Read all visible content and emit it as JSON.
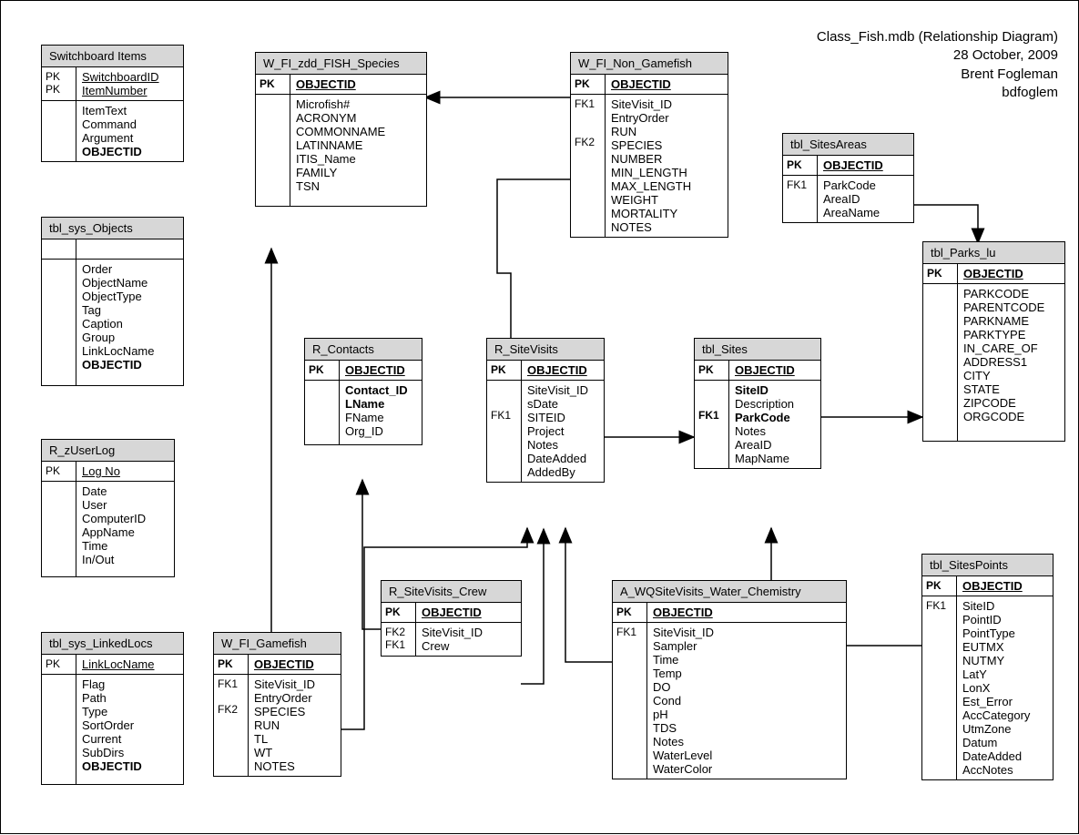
{
  "header": {
    "line1": "Class_Fish.mdb (Relationship Diagram)",
    "line2": "28 October, 2009",
    "line3": "Brent Fogleman",
    "line4": "bdfoglem"
  },
  "tables": {
    "switchboard": {
      "title": "Switchboard Items",
      "pk1_key": "PK",
      "pk1_field": "SwitchboardID",
      "pk2_key": "PK",
      "pk2_field": "ItemNumber",
      "f1": "ItemText",
      "f2": "Command",
      "f3": "Argument",
      "f4": "OBJECTID"
    },
    "sys_objects": {
      "title": "tbl_sys_Objects",
      "f1": "Order",
      "f2": "ObjectName",
      "f3": "ObjectType",
      "f4": "Tag",
      "f5": "Caption",
      "f6": "Group",
      "f7": "LinkLocName",
      "f8": "OBJECTID"
    },
    "userlog": {
      "title": "R_zUserLog",
      "pk_key": "PK",
      "pk_field": "Log No",
      "f1": "Date",
      "f2": "User",
      "f3": "ComputerID",
      "f4": "AppName",
      "f5": "Time",
      "f6": "In/Out"
    },
    "linkedlocs": {
      "title": "tbl_sys_LinkedLocs",
      "pk_key": "PK",
      "pk_field": "LinkLocName",
      "f1": "Flag",
      "f2": "Path",
      "f3": "Type",
      "f4": "SortOrder",
      "f5": "Current",
      "f6": "SubDirs",
      "f7": "OBJECTID"
    },
    "fish_species": {
      "title": "W_FI_zdd_FISH_Species",
      "pk_key": "PK",
      "pk_field": "OBJECTID",
      "f1": "Microfish#",
      "f2": "ACRONYM",
      "f3": "COMMONNAME",
      "f4": "LATINNAME",
      "f5": "ITIS_Name",
      "f6": "FAMILY",
      "f7": "TSN"
    },
    "non_gamefish": {
      "title": "W_FI_Non_Gamefish",
      "pk_key": "PK",
      "pk_field": "OBJECTID",
      "k1": "FK1",
      "f1": "SiteVisit_ID",
      "f2": "EntryOrder",
      "f3": "RUN",
      "k4": "FK2",
      "f4": "SPECIES",
      "f5": "NUMBER",
      "f6": "MIN_LENGTH",
      "f7": "MAX_LENGTH",
      "f8": "WEIGHT",
      "f9": "MORTALITY",
      "f10": "NOTES"
    },
    "sitesareas": {
      "title": "tbl_SitesAreas",
      "pk_key": "PK",
      "pk_field": "OBJECTID",
      "k1": "FK1",
      "f1": "ParkCode",
      "f2": "AreaID",
      "f3": "AreaName"
    },
    "parks": {
      "title": "tbl_Parks_lu",
      "pk_key": "PK",
      "pk_field": "OBJECTID",
      "f1": "PARKCODE",
      "f2": "PARENTCODE",
      "f3": "PARKNAME",
      "f4": "PARKTYPE",
      "f5": "IN_CARE_OF",
      "f6": "ADDRESS1",
      "f7": "CITY",
      "f8": "STATE",
      "f9": "ZIPCODE",
      "f10": "ORGCODE"
    },
    "contacts": {
      "title": "R_Contacts",
      "pk_key": "PK",
      "pk_field": "OBJECTID",
      "f1": "Contact_ID",
      "f2": "LName",
      "f3": "FName",
      "f4": "Org_ID"
    },
    "sitevisits": {
      "title": "R_SiteVisits",
      "pk_key": "PK",
      "pk_field": "OBJECTID",
      "f1": "SiteVisit_ID",
      "f2": "sDate",
      "k3": "FK1",
      "f3": "SITEID",
      "f4": "Project",
      "f5": "Notes",
      "f6": "DateAdded",
      "f7": "AddedBy"
    },
    "sites": {
      "title": "tbl_Sites",
      "pk_key": "PK",
      "pk_field": "OBJECTID",
      "f1": "SiteID",
      "f2": "Description",
      "k3": "FK1",
      "f3": "ParkCode",
      "f4": "Notes",
      "f5": "AreaID",
      "f6": "MapName"
    },
    "gamefish": {
      "title": "W_FI_Gamefish",
      "pk_key": "PK",
      "pk_field": "OBJECTID",
      "k1": "FK1",
      "f1": "SiteVisit_ID",
      "f2": "EntryOrder",
      "k3": "FK2",
      "f3": "SPECIES",
      "f4": "RUN",
      "f5": "TL",
      "f6": "WT",
      "f7": "NOTES"
    },
    "sitevisits_crew": {
      "title": "R_SiteVisits_Crew",
      "pk_key": "PK",
      "pk_field": "OBJECTID",
      "k1": "FK2",
      "f1": "SiteVisit_ID",
      "k2": "FK1",
      "f2": "Crew"
    },
    "waterchem": {
      "title": "A_WQSiteVisits_Water_Chemistry",
      "pk_key": "PK",
      "pk_field": "OBJECTID",
      "k1": "FK1",
      "f1": "SiteVisit_ID",
      "f2": "Sampler",
      "f3": "Time",
      "f4": "Temp",
      "f5": "DO",
      "f6": "Cond",
      "f7": "pH",
      "f8": "TDS",
      "f9": "Notes",
      "f10": "WaterLevel",
      "f11": "WaterColor"
    },
    "sitespoints": {
      "title": "tbl_SitesPoints",
      "pk_key": "PK",
      "pk_field": "OBJECTID",
      "k1": "FK1",
      "f1": "SiteID",
      "f2": "PointID",
      "f3": "PointType",
      "f4": "EUTMX",
      "f5": "NUTMY",
      "f6": "LatY",
      "f7": "LonX",
      "f8": "Est_Error",
      "f9": "AccCategory",
      "f10": "UtmZone",
      "f11": "Datum",
      "f12": "DateAdded",
      "f13": "AccNotes"
    }
  }
}
